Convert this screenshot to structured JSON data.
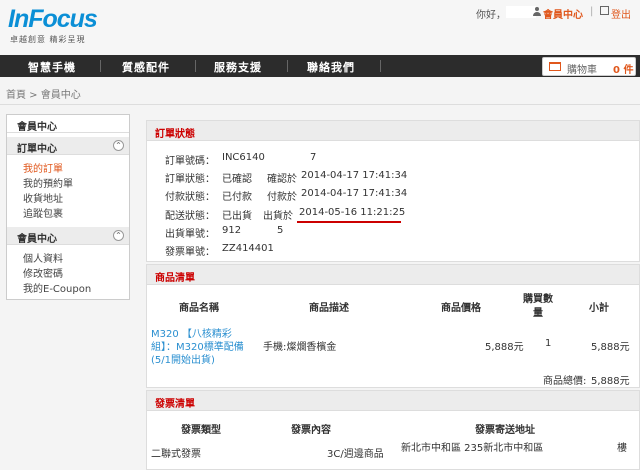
{
  "header": {
    "logo": "InFocus",
    "logo_tagline": "卓越創意 精彩呈現",
    "greeting": "你好，",
    "member_center": "會員中心",
    "separator": "|",
    "logout": "登出"
  },
  "nav": {
    "items": [
      "智慧手機",
      "質感配件",
      "服務支援",
      "聯絡我們"
    ],
    "cart_label": "購物車",
    "cart_count": "0 件"
  },
  "breadcrumb": "首頁 > 會員中心",
  "sidebar": {
    "title": "會員中心",
    "order_section": "訂單中心",
    "order_items": [
      "我的訂單",
      "我的預約單",
      "收貨地址",
      "追蹤包裹"
    ],
    "member_section": "會員中心",
    "member_items": [
      "個人資料",
      "修改密碼",
      "我的E-Coupon"
    ],
    "toggle": "⌃"
  },
  "order_status": {
    "title": "訂單狀態",
    "order_no_label": "訂單號碼：",
    "order_no_a": "INC6140",
    "order_no_b": "7",
    "order_state_label": "訂單狀態：",
    "order_state": "已確認",
    "confirm_label": "確認於",
    "confirm_time": "2014-04-17 17:41:34",
    "pay_state_label": "付款狀態：",
    "pay_state": "已付款",
    "pay_label": "付款於",
    "pay_time": "2014-04-17 17:41:34",
    "ship_state_label": "配送狀態：",
    "ship_state": "已出貨",
    "ship_label": "出貨於",
    "ship_time": "2014-05-16 11:21:25",
    "ship_no_label": "出貨單號：",
    "ship_no_a": "912",
    "ship_no_b": "5",
    "invoice_no_label": "發票單號：",
    "invoice_no": "ZZ414401"
  },
  "product_list": {
    "title": "商品清單",
    "columns": [
      "商品名稱",
      "商品描述",
      "商品價格",
      "購買數量",
      "小計"
    ],
    "product_name_lines": [
      "M320 【八核精彩",
      "組】：M320標準配備",
      "(5/1開始出貨)"
    ],
    "description": "手機:燦爛香檳金",
    "price": "5,888元",
    "qty": "1",
    "subtotal": "5,888元",
    "total_label": "商品總價:",
    "total_value": "5,888元"
  },
  "invoice_list": {
    "title": "發票清單",
    "columns": [
      "發票類型",
      "發票內容",
      "發票寄送地址"
    ],
    "type": "二聯式發票",
    "content": "3C/週邊商品",
    "address": "新北市中和區 235新北市中和區",
    "address_tail": "樓"
  },
  "colors": {
    "accent": "#e0571c",
    "brand": "#0b8fd6",
    "title_red": "#c00000",
    "underline": "#cc0000"
  }
}
